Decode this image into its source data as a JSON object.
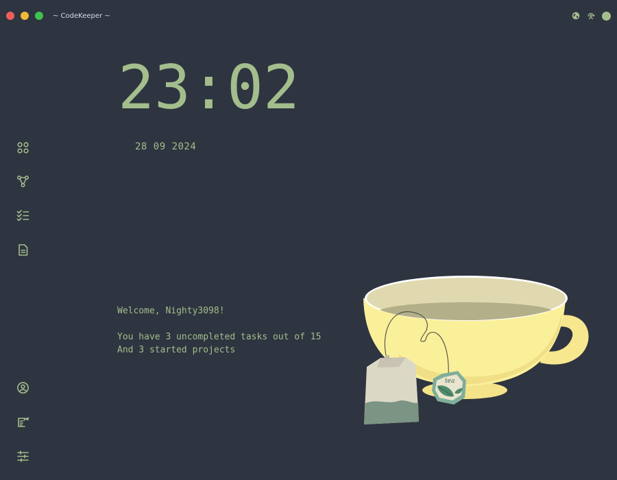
{
  "window": {
    "title": "~ CodeKeeper ~",
    "controls": [
      "close",
      "minimize",
      "maximize"
    ],
    "right_icons": [
      "globe-icon",
      "user-sync-icon",
      "status-dot"
    ]
  },
  "sidebar": {
    "items_top": [
      {
        "icon": "apps-grid-icon"
      },
      {
        "icon": "git-branch-icon"
      },
      {
        "icon": "checklist-icon"
      },
      {
        "icon": "document-icon"
      }
    ],
    "items_bottom": [
      {
        "icon": "user-circle-icon"
      },
      {
        "icon": "tasks-refresh-icon"
      },
      {
        "icon": "sliders-icon"
      }
    ]
  },
  "clock": {
    "time": "23:02",
    "date": "28 09 2024"
  },
  "greeting": {
    "welcome": "Welcome, Nighty3098!",
    "tasks_line": "You have 3 uncompleted tasks out of 15",
    "projects_line": "And 3 started projects"
  },
  "illustration": {
    "name": "teacup-with-teabag",
    "tag_text": "tea"
  },
  "colors": {
    "background": "#2e3440",
    "accent": "#a3be8c",
    "title_text": "#d8dee9",
    "close": "#ed5f5a",
    "minimize": "#f2b83a",
    "maximize": "#3fc350",
    "cup": "#fbf09a"
  }
}
